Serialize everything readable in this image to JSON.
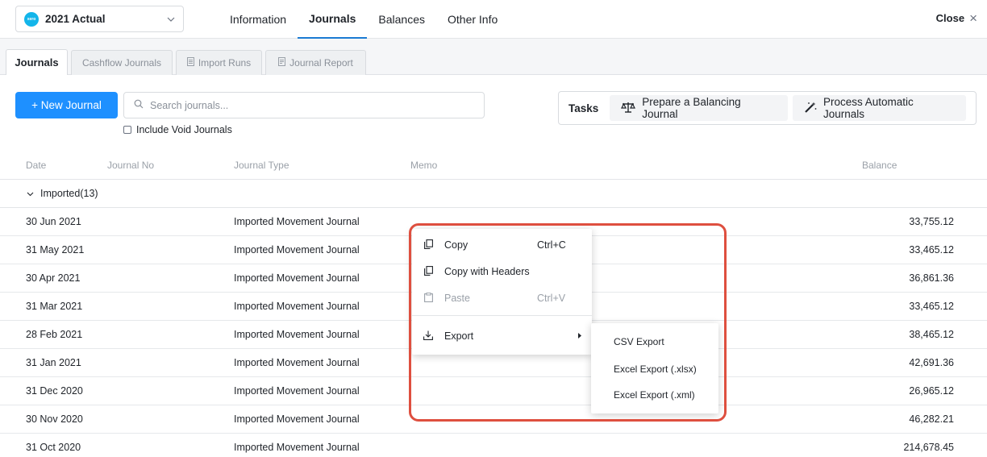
{
  "header": {
    "entity": {
      "logo_text": "xero",
      "label": "2021 Actual",
      "icon": "chevron-down-icon"
    },
    "nav": [
      {
        "label": "Information"
      },
      {
        "label": "Journals",
        "active": true
      },
      {
        "label": "Balances"
      },
      {
        "label": "Other Info"
      }
    ],
    "close_label": "Close",
    "close_icon": "×"
  },
  "subtabs": [
    {
      "label": "Journals",
      "active": true
    },
    {
      "label": "Cashflow Journals"
    },
    {
      "label": "Import Runs",
      "icon": "document-icon"
    },
    {
      "label": "Journal Report",
      "icon": "report-icon"
    }
  ],
  "toolbar": {
    "new_journal_label": "+ New Journal",
    "search_placeholder": "Search journals...",
    "include_void_label": "Include Void Journals",
    "include_void_checked": false,
    "tasks_label": "Tasks",
    "task_buttons": [
      {
        "label": "Prepare a Balancing Journal",
        "icon": "balance-scale-icon"
      },
      {
        "label": "Process Automatic Journals",
        "icon": "magic-wand-icon"
      }
    ]
  },
  "table": {
    "columns": [
      "Date",
      "Journal No",
      "Journal Type",
      "Memo",
      "Balance"
    ],
    "group": {
      "label": "Imported",
      "count": "(13)"
    },
    "rows": [
      {
        "date": "30 Jun 2021",
        "type": "Imported Movement Journal",
        "balance": "33,755.12"
      },
      {
        "date": "31 May 2021",
        "type": "Imported Movement Journal",
        "balance": "33,465.12"
      },
      {
        "date": "30 Apr 2021",
        "type": "Imported Movement Journal",
        "balance": "36,861.36"
      },
      {
        "date": "31 Mar 2021",
        "type": "Imported Movement Journal",
        "balance": "33,465.12"
      },
      {
        "date": "28 Feb 2021",
        "type": "Imported Movement Journal",
        "balance": "38,465.12"
      },
      {
        "date": "31 Jan 2021",
        "type": "Imported Movement Journal",
        "balance": "42,691.36"
      },
      {
        "date": "31 Dec 2020",
        "type": "Imported Movement Journal",
        "balance": "26,965.12"
      },
      {
        "date": "30 Nov 2020",
        "type": "Imported Movement Journal",
        "balance": "46,282.21"
      },
      {
        "date": "31 Oct 2020",
        "type": "Imported Movement Journal",
        "balance": "214,678.45"
      }
    ]
  },
  "context_menu": {
    "items": [
      {
        "label": "Copy",
        "shortcut": "Ctrl+C",
        "icon": "copy-icon"
      },
      {
        "label": "Copy with Headers",
        "shortcut": "",
        "icon": "copy-icon"
      },
      {
        "label": "Paste",
        "shortcut": "Ctrl+V",
        "icon": "paste-icon",
        "disabled": true
      },
      {
        "label": "Export",
        "shortcut": "",
        "icon": "download-icon",
        "has_submenu": true
      }
    ],
    "export_submenu": [
      {
        "label": "CSV Export"
      },
      {
        "label": "Excel Export (.xlsx)"
      },
      {
        "label": "Excel Export (.xml)"
      }
    ]
  },
  "colors": {
    "primary": "#1e90ff",
    "active_tab_underline": "#1b7bd3",
    "highlight_outline": "#de4f3f",
    "xero_brand": "#13b5ea"
  }
}
